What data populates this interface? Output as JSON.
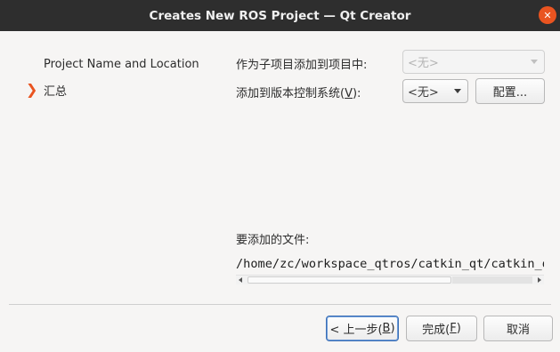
{
  "window": {
    "title": "Creates New ROS Project — Qt Creator",
    "close_glyph": "✕"
  },
  "sidebar": {
    "items": [
      {
        "label": "Project Name and Location",
        "active": false
      },
      {
        "label": "汇总",
        "active": true
      }
    ],
    "active_marker_glyph": "❯"
  },
  "main": {
    "subproject_label": "作为子项目添加到项目中:",
    "subproject_value": "<无>",
    "vcs_label_prefix": "添加到版本控制系统(",
    "vcs_label_mnemonic": "V",
    "vcs_label_suffix": "):",
    "vcs_value": "<无>",
    "configure_button": "配置...",
    "files_label": "要添加的文件:",
    "file_path": "/home/zc/workspace_qtros/catkin_qt/catkin_qt"
  },
  "footer": {
    "back_prefix": "< 上一步(",
    "back_mnemonic": "B",
    "back_suffix": ")",
    "finish_prefix": "完成(",
    "finish_mnemonic": "F",
    "finish_suffix": ")",
    "cancel": "取消"
  },
  "colors": {
    "accent": "#e95420",
    "titlebar": "#2e2e2e",
    "background": "#f6f5f4",
    "focus_border": "#3b6fb6"
  }
}
